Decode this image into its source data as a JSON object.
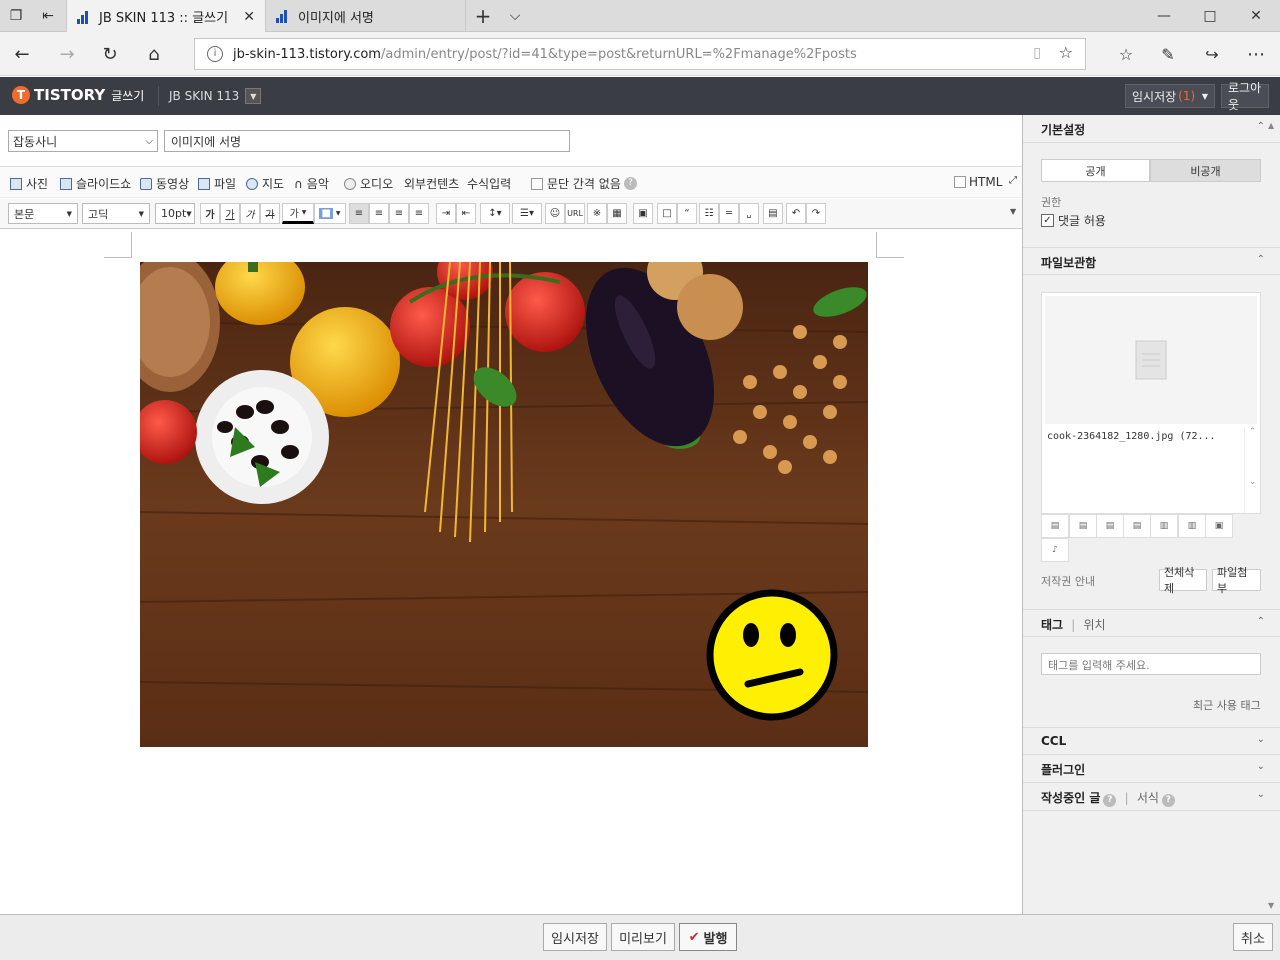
{
  "browser": {
    "tabs": [
      {
        "title": "JB SKIN 113 :: 글쓰기",
        "active": true
      },
      {
        "title": "이미지에 서명",
        "active": false
      }
    ],
    "url_host": "jb-skin-113.tistory.com",
    "url_path": "/admin/entry/post/?id=41&type=post&returnURL=%2Fmanage%2Fposts"
  },
  "header": {
    "logo": "TISTORY",
    "logo_sub": "글쓰기",
    "blog_name": "JB SKIN 113",
    "draft_label": "임시저장",
    "draft_count": "1",
    "logout_label": "로그아웃"
  },
  "editor": {
    "category": "잡동사니",
    "title": "이미지에 서명",
    "attach": {
      "photo": "사진",
      "slideshow": "슬라이드쇼",
      "video": "동영상",
      "file": "파일",
      "map": "지도",
      "music": "음악",
      "audio": "오디오",
      "external": "외부컨텐츠",
      "formula": "수식입력",
      "no_para_spacing": "문단 간격 없음",
      "html": "HTML"
    },
    "format": {
      "block": "본문",
      "font": "고딕",
      "size": "10pt",
      "bold": "가",
      "underline": "가",
      "italic": "가",
      "strike": "가",
      "color": "가",
      "url": "URL"
    }
  },
  "sidebar": {
    "basic": {
      "title": "기본설정",
      "public": "공개",
      "private": "비공개",
      "permission": "권한",
      "allow_comments": "댓글 허용"
    },
    "files": {
      "title": "파일보관함",
      "file_name": "cook-2364182_1280.jpg (72...",
      "copyright": "저작권 안내",
      "delete_all": "전체삭제",
      "attach": "파일첨부"
    },
    "tags": {
      "title": "태그",
      "location": "위치",
      "placeholder": "태그를 입력해 주세요.",
      "recent": "최근 사용 태그"
    },
    "ccl": "CCL",
    "plugin": "플러그인",
    "drafts": "작성중인 글",
    "format": "서식"
  },
  "bottom": {
    "save_draft": "임시저장",
    "preview": "미리보기",
    "publish": "발행",
    "cancel": "취소"
  },
  "colors": {
    "header_bg": "#3a3d44",
    "tistory_orange": "#f06b2f",
    "publish_check": "#e0202a"
  }
}
